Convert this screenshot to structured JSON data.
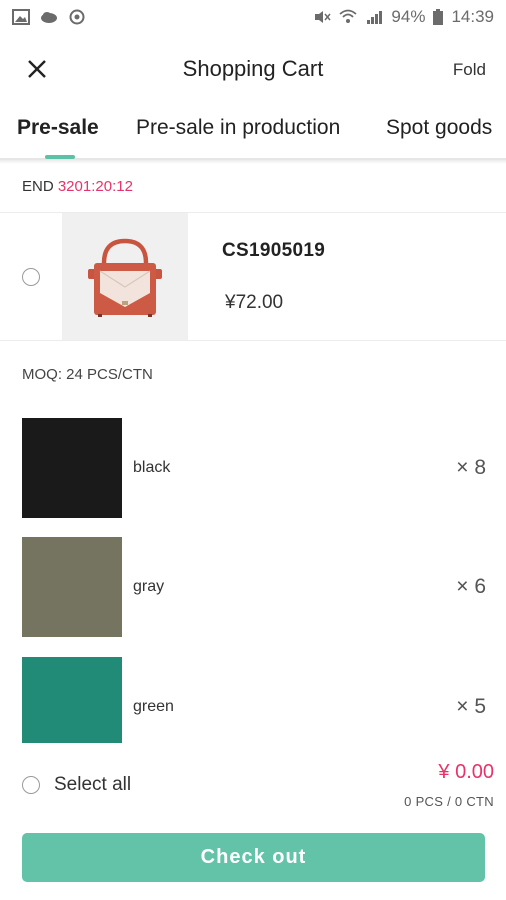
{
  "status_bar": {
    "battery": "94%",
    "time": "14:39",
    "icons": [
      "image-icon",
      "cloud-icon",
      "sync-icon",
      "mute-icon",
      "wifi-icon",
      "signal-icon",
      "battery-icon"
    ]
  },
  "header": {
    "title": "Shopping Cart",
    "fold_label": "Fold",
    "close_icon": "close-icon"
  },
  "tabs": [
    {
      "label": "Pre-sale",
      "active": true
    },
    {
      "label": "Pre-sale in production",
      "active": false
    },
    {
      "label": "Spot goods",
      "active": false
    }
  ],
  "countdown": {
    "prefix": "END",
    "value": "3201:20:12",
    "color": "#e8336a"
  },
  "product": {
    "code": "CS1905019",
    "price": "¥72.00",
    "image": "red-handbag"
  },
  "moq": "MOQ: 24 PCS/CTN",
  "colors": [
    {
      "name": "black",
      "qty": "× 8",
      "swatch": "#1a1a1a"
    },
    {
      "name": "gray",
      "qty": "× 6",
      "swatch": "#747461"
    },
    {
      "name": "green",
      "qty": "× 5",
      "swatch": "#218b77"
    }
  ],
  "footer": {
    "select_all_label": "Select all",
    "total_price": "¥ 0.00",
    "total_count": "0 PCS / 0 CTN",
    "checkout_label": "Check out"
  },
  "theme": {
    "accent": "#5cc1a6",
    "checkout_bg": "#62c3a9",
    "price_color": "#e8336a"
  }
}
